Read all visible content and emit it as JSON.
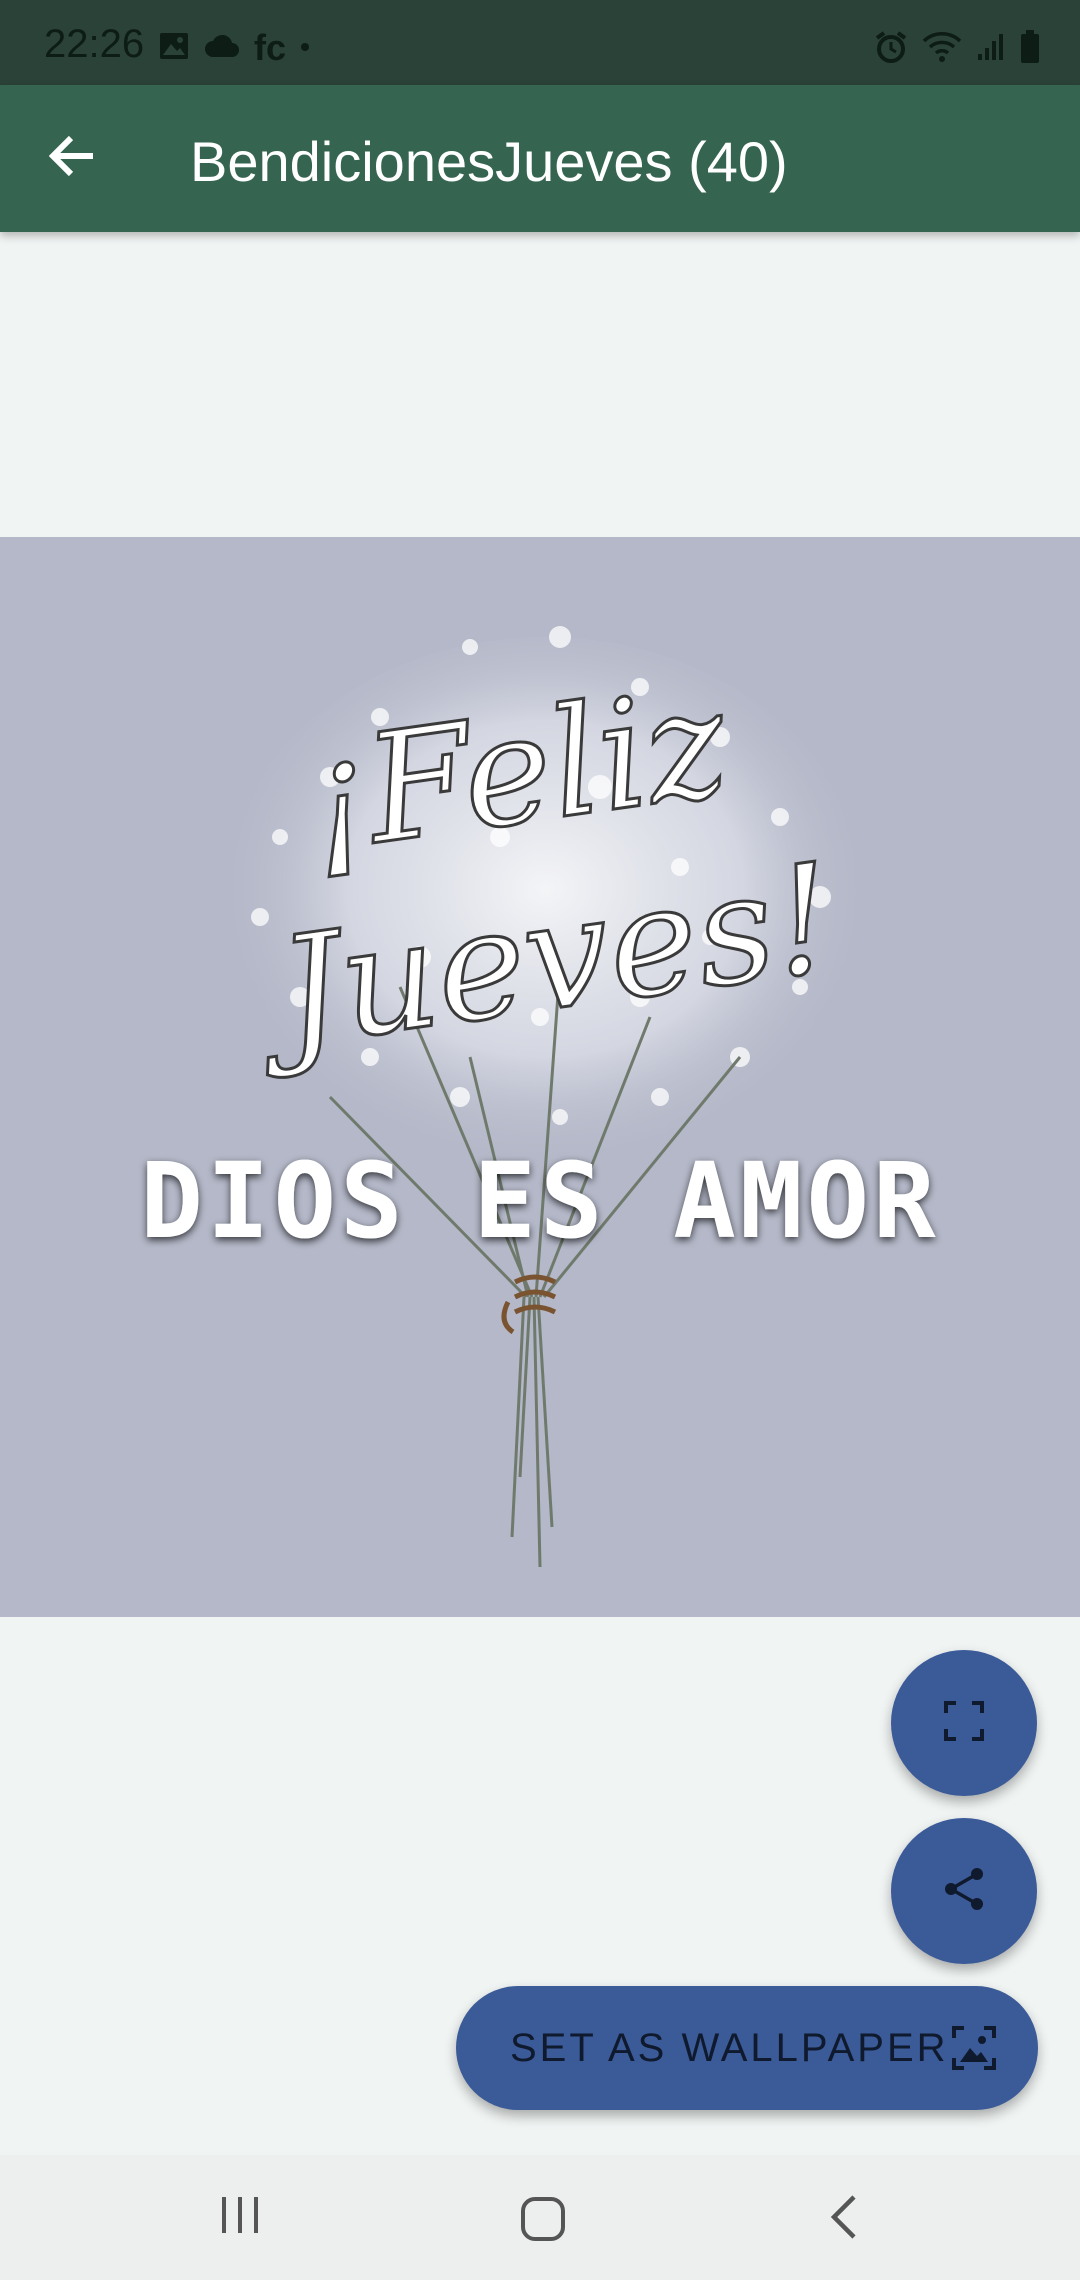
{
  "status_bar": {
    "time": "22:26",
    "left_icons": [
      "image-icon",
      "cloud-icon",
      "fc",
      "dot-icon"
    ],
    "right_icons": [
      "alarm-icon",
      "wifi-icon",
      "signal-icon",
      "battery-icon"
    ],
    "fc_text": "fc"
  },
  "app_bar": {
    "title": "BendicionesJueves (40)",
    "back_icon": "arrow-back-icon",
    "color": "#356550"
  },
  "image": {
    "script_line1": "¡Feliz",
    "script_line2": "Jueves!",
    "caption": "DIOS ES AMOR",
    "background": "#b4b8c8"
  },
  "actions": {
    "fullscreen_icon": "fullscreen-icon",
    "share_icon": "share-icon",
    "wallpaper_label": "SET AS WALLPAPER",
    "wallpaper_icon": "wallpaper-icon",
    "accent": "#3b5a98"
  },
  "nav_bar": {
    "recents_icon": "recents-icon",
    "home_icon": "home-icon",
    "back_icon": "back-chevron-icon"
  }
}
